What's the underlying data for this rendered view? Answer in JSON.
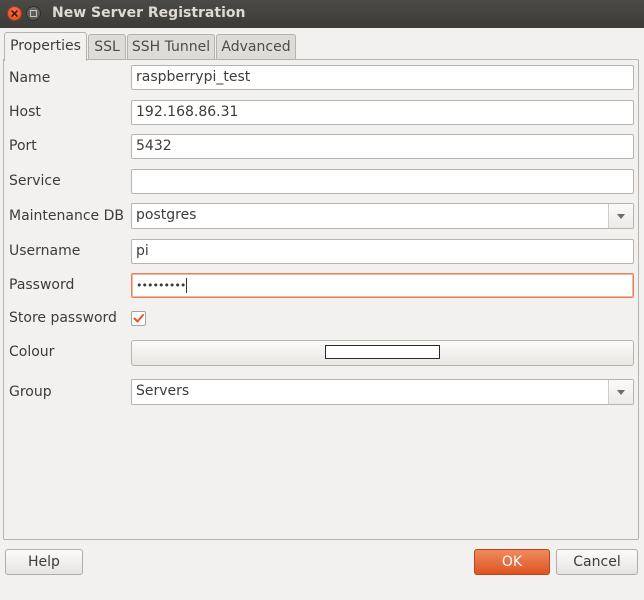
{
  "window": {
    "title": "New Server Registration"
  },
  "tabs": [
    {
      "label": "Properties",
      "active": true
    },
    {
      "label": "SSL"
    },
    {
      "label": "SSH Tunnel"
    },
    {
      "label": "Advanced"
    }
  ],
  "form": {
    "name": {
      "label": "Name",
      "value": "raspberrypi_test"
    },
    "host": {
      "label": "Host",
      "value": "192.168.86.31"
    },
    "port": {
      "label": "Port",
      "value": "5432"
    },
    "service": {
      "label": "Service",
      "value": ""
    },
    "maintenance": {
      "label": "Maintenance DB",
      "value": "postgres"
    },
    "username": {
      "label": "Username",
      "value": "pi"
    },
    "password": {
      "label": "Password",
      "value": "•••••••••"
    },
    "store": {
      "label": "Store password",
      "checked": true
    },
    "colour": {
      "label": "Colour",
      "value": "#ffffff"
    },
    "group": {
      "label": "Group",
      "value": "Servers"
    }
  },
  "buttons": {
    "help": "Help",
    "ok": "OK",
    "cancel": "Cancel"
  },
  "colors": {
    "accent": "#e95420",
    "titlebar": "#3c3b37",
    "background": "#f2f1f0"
  }
}
